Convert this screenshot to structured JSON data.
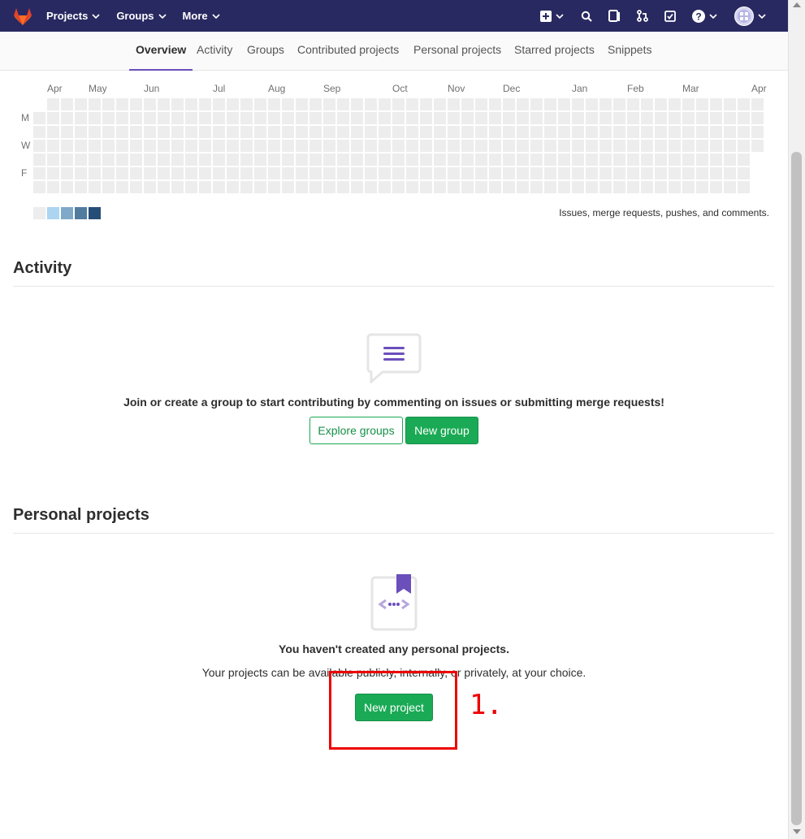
{
  "navbar": {
    "menu": [
      {
        "label": "Projects"
      },
      {
        "label": "Groups"
      },
      {
        "label": "More"
      }
    ],
    "icons": [
      "plus-square-icon",
      "search-icon",
      "todo-icon",
      "merge-request-icon",
      "checklist-icon",
      "help-icon",
      "avatar"
    ]
  },
  "tabs": [
    "Overview",
    "Activity",
    "Groups",
    "Contributed projects",
    "Personal projects",
    "Starred projects",
    "Snippets"
  ],
  "calendar": {
    "months": [
      "Apr",
      "May",
      "Jun",
      "Jul",
      "Aug",
      "Sep",
      "Oct",
      "Nov",
      "Dec",
      "Jan",
      "Feb",
      "Mar",
      "Apr"
    ],
    "days": [
      "M",
      "W",
      "F"
    ],
    "legend_text": "Issues, merge requests, pushes, and comments.",
    "legend_colors": [
      "#ededed",
      "#acd5f2",
      "#7fa8c9",
      "#527ba0",
      "#254e77"
    ]
  },
  "activity": {
    "title": "Activity",
    "empty_text": "Join or create a group to start contributing by commenting on issues or submitting merge requests!",
    "explore_button": "Explore groups",
    "new_group_button": "New group"
  },
  "personal_projects": {
    "title": "Personal projects",
    "empty_title": "You haven't created any personal projects.",
    "empty_text": "Your projects can be available publicly, internally, or privately, at your choice.",
    "new_project_button": "New project"
  },
  "annotation": {
    "label": "1."
  },
  "colors": {
    "navbar": "#292961",
    "accent": "#6b4fbb",
    "green": "#1aaa55",
    "annotation": "#ee0000"
  }
}
